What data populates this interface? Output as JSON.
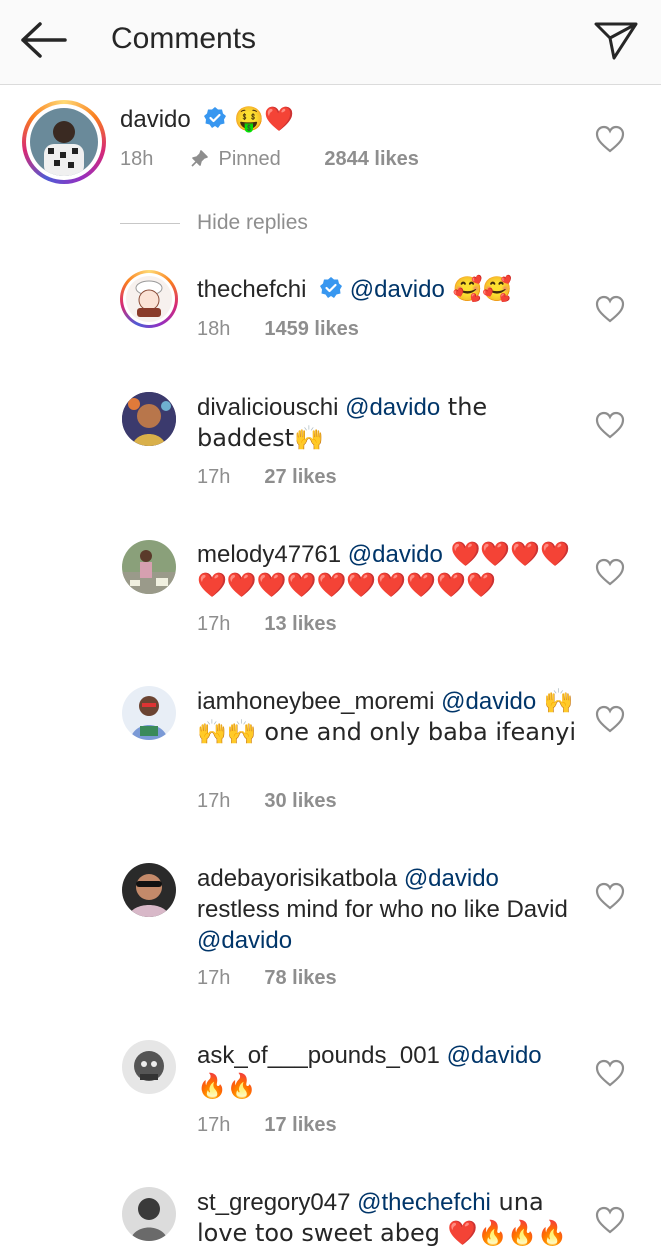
{
  "header": {
    "title": "Comments",
    "back_icon": "arrow-left-icon",
    "share_icon": "paper-plane-icon"
  },
  "pinned": {
    "username": "davido",
    "emoji": "🤑❤️",
    "time": "18h",
    "pinned_label": "Pinned",
    "likes": "2844 likes"
  },
  "hide_replies": "Hide replies",
  "replies": [
    {
      "username": "thechefchi",
      "verified": true,
      "mention": "@davido",
      "text": " 🥰🥰",
      "time": "18h",
      "likes": "1459 likes"
    },
    {
      "username": "divaliciouschi",
      "mention": "@davido",
      "text": " the baddest🙌",
      "time": "17h",
      "likes": "27 likes"
    },
    {
      "username": "melody47761",
      "mention": "@davido",
      "text": " ❤️❤️❤️❤️❤️❤️❤️❤️❤️❤️❤️❤️❤️❤️",
      "time": "17h",
      "likes": "13 likes"
    },
    {
      "username": "iamhoneybee_moremi",
      "mention": "@davido",
      "text": " 🙌🙌🙌 one and only baba ifeanyi",
      "time": "17h",
      "likes": "30 likes"
    },
    {
      "username": "adebayorisikatbola",
      "mention": "@davido",
      "text": " restless mind for who no like David ",
      "mention2": "@davido",
      "time": "17h",
      "likes": "78 likes"
    },
    {
      "username": "ask_of___pounds_001",
      "mention": "@davido",
      "text": " 🔥🔥",
      "time": "17h",
      "likes": "17 likes"
    },
    {
      "username": "st_gregory047",
      "mention": "@thechefchi",
      "text": " una love too sweet abeg ❤️🔥🔥🔥",
      "time": "",
      "likes": ""
    }
  ],
  "colors": {
    "mention": "#003569",
    "meta": "#8e8e8e",
    "verified": "#3897f0",
    "heart_emoji": "#e0142a"
  }
}
